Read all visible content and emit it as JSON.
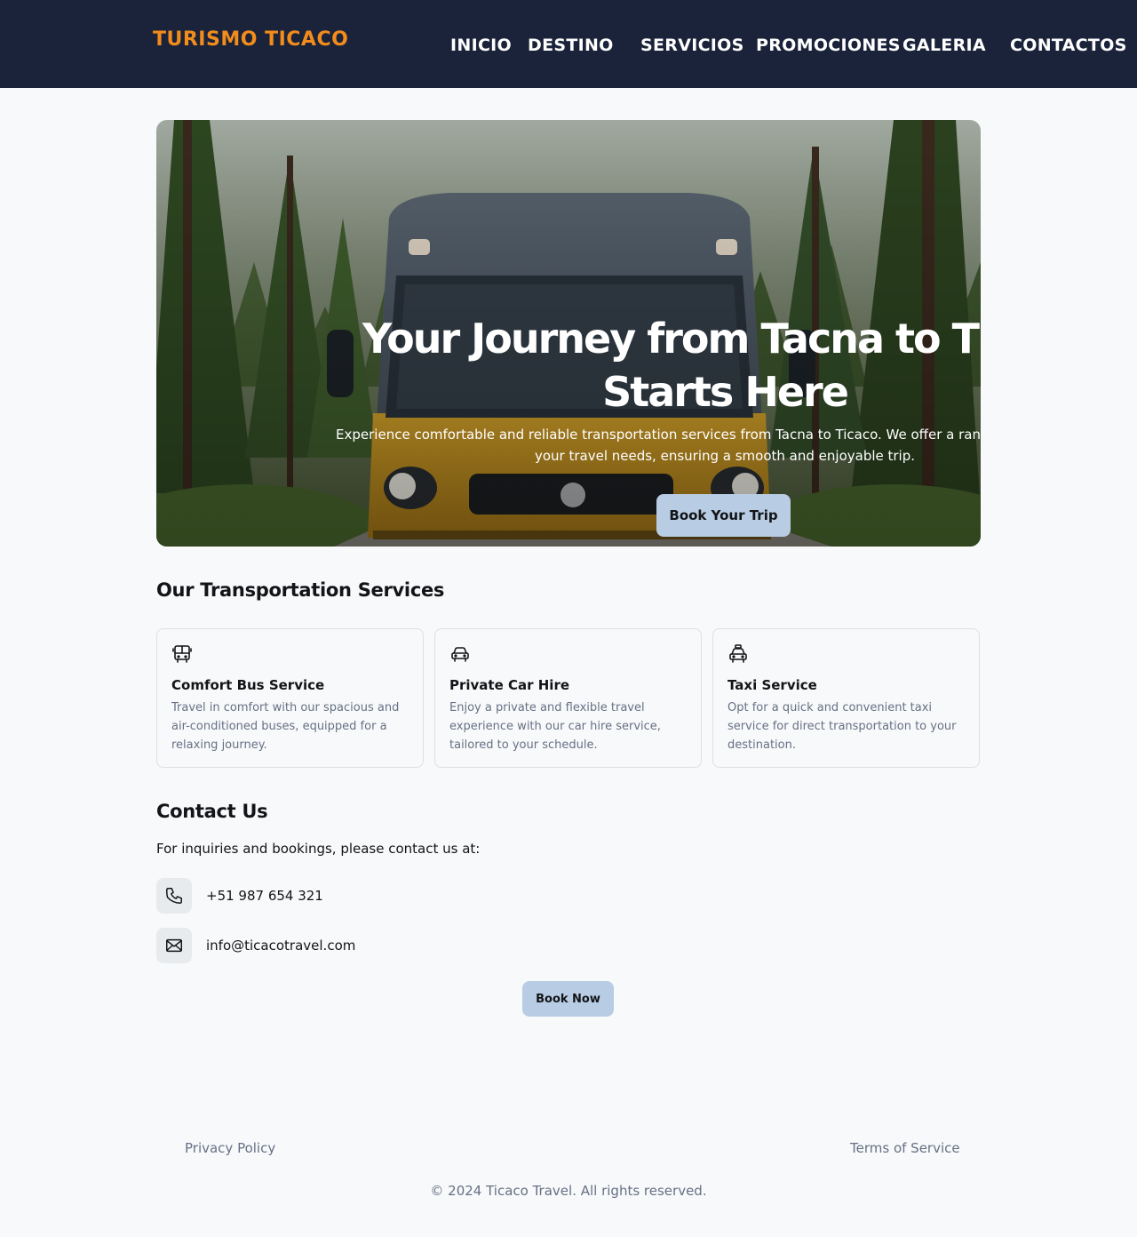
{
  "header": {
    "brand": "TURISMO TICACO",
    "nav": [
      "INICIO",
      "DESTINO",
      "SERVICIOS",
      "PROMOCIONES",
      "GALERIA",
      "CONTACTOS"
    ]
  },
  "hero": {
    "title": "Your Journey from Tacna to Ticaco Starts Here",
    "subtitle": "Experience comfortable and reliable transportation services from Tacna to Ticaco. We offer a range of options to suit your travel needs, ensuring a smooth and enjoyable trip.",
    "button": "Book Your Trip"
  },
  "services": {
    "title": "Our Transportation Services",
    "items": [
      {
        "icon": "bus-icon",
        "title": "Comfort Bus Service",
        "text": "Travel in comfort with our spacious and air-conditioned buses, equipped for a relaxing journey."
      },
      {
        "icon": "car-icon",
        "title": "Private Car Hire",
        "text": "Enjoy a private and flexible travel experience with our car hire service, tailored to your schedule."
      },
      {
        "icon": "taxi-icon",
        "title": "Taxi Service",
        "text": "Opt for a quick and convenient taxi service for direct transportation to your destination."
      }
    ]
  },
  "contact": {
    "title": "Contact Us",
    "intro": "For inquiries and bookings, please contact us at:",
    "phone": "+51 987 654 321",
    "email": "info@ticacotravel.com",
    "button": "Book Now"
  },
  "footer": {
    "privacy": "Privacy Policy",
    "terms": "Terms of Service",
    "copyright": "© 2024 Ticaco Travel. All rights reserved."
  },
  "colors": {
    "header_bg": "#1b233a",
    "brand": "#f28c1b",
    "button_bg": "#b8cce4",
    "muted_text": "#667085"
  }
}
